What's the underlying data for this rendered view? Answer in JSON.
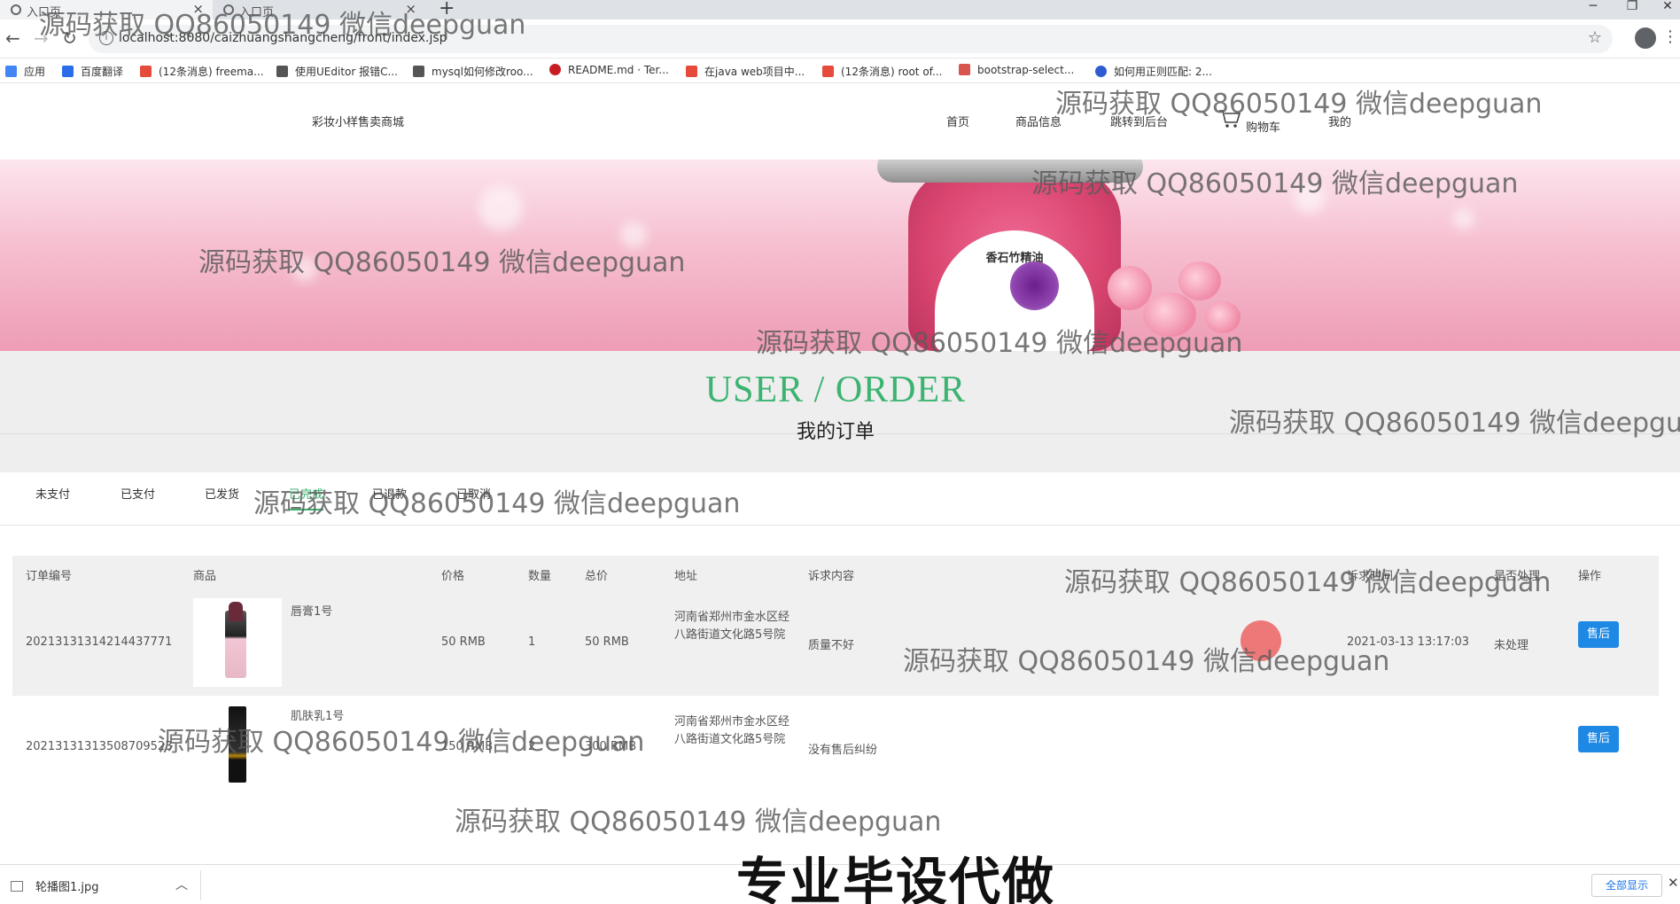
{
  "browser": {
    "tabs": [
      {
        "title": "入口页",
        "active": true
      },
      {
        "title": "入口页",
        "active": false
      }
    ],
    "new_tab": "+",
    "window_controls": [
      "─",
      "❐",
      "✕"
    ],
    "url": "localhost:8080/caizhuangshangcheng/front/index.jsp",
    "bookmarks": [
      {
        "label": "应用",
        "color": "#4285f4"
      },
      {
        "label": "百度翻译",
        "color": "#2b6de8"
      },
      {
        "label": "(12条消息) freema...",
        "color": "#e64a3b"
      },
      {
        "label": "使用UEditor 报错C...",
        "color": "#555555"
      },
      {
        "label": "mysql如何修改roo...",
        "color": "#555555"
      },
      {
        "label": "README.md · Ter...",
        "color": "#c71d23"
      },
      {
        "label": "在java web项目中...",
        "color": "#e64a3b"
      },
      {
        "label": "(12条消息) root of...",
        "color": "#e64a3b"
      },
      {
        "label": "bootstrap-select...",
        "color": "#d9534f"
      },
      {
        "label": "如何用正则匹配: 2...",
        "color": "#2f5bd1"
      }
    ]
  },
  "site": {
    "brand": "彩妆小样售卖商城",
    "nav": {
      "home": "首页",
      "products": "商品信息",
      "admin": "跳转到后台",
      "cart": "购物车",
      "mine": "我的"
    },
    "banner": {
      "label": "香石竹精油"
    },
    "section_en": "USER / ORDER",
    "section_cn": "我的订单",
    "order_tabs": [
      "未支付",
      "已支付",
      "已发货",
      "已完成",
      "已退款",
      "已取消"
    ],
    "table": {
      "headers": {
        "order_no": "订单编号",
        "product": "商品",
        "price": "价格",
        "qty": "数量",
        "total": "总价",
        "address": "地址",
        "complaint": "诉求内容",
        "time": "诉求时间",
        "handled": "是否处理",
        "action": "操作"
      },
      "rows": [
        {
          "order_no": "20213131314214437771",
          "product": "唇膏1号",
          "price": "50 RMB",
          "qty": "1",
          "total": "50 RMB",
          "address": "河南省郑州市金水区经八路街道文化路5号院",
          "complaint": "质量不好",
          "time": "2021-03-13 13:17:03",
          "handled": "未处理",
          "action": "售后"
        },
        {
          "order_no": "20213131313508709523",
          "product": "肌肤乳1号",
          "price": "150 RMB",
          "qty": "2",
          "total": "300 RMB",
          "address": "河南省郑州市金水区经八路街道文化路5号院",
          "complaint": "没有售后纠纷",
          "time": "",
          "handled": "",
          "action": "售后"
        }
      ]
    }
  },
  "download_bar": {
    "file": "轮播图1.jpg",
    "show_all": "全部显示"
  },
  "overlay": {
    "watermark": "源码获取 QQ86050149 微信deepguan",
    "caption": "专业毕设代做"
  }
}
